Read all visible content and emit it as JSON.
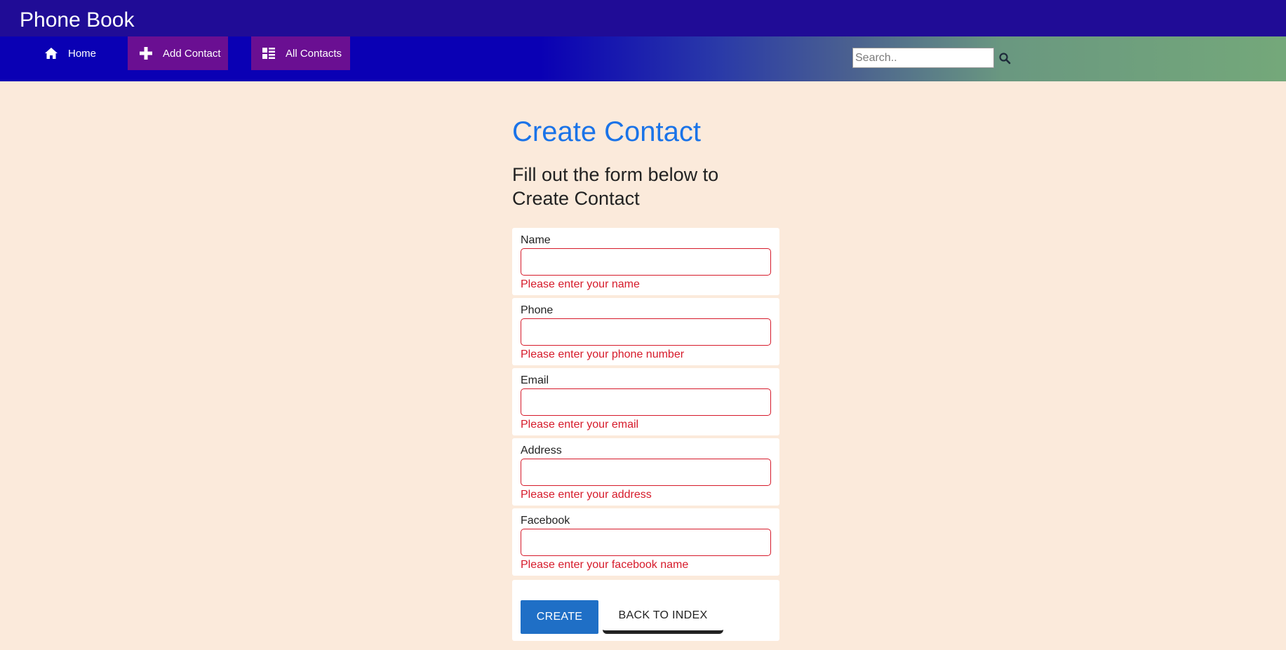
{
  "app": {
    "brand": "Phone Book"
  },
  "nav": {
    "home": "Home",
    "add_contact": "Add Contact",
    "all_contacts": "All Contacts",
    "search_placeholder": "Search..",
    "search_value": ""
  },
  "page": {
    "title": "Create Contact",
    "subtitle": "Fill out the form below to Create Contact"
  },
  "form": {
    "fields": [
      {
        "label": "Name",
        "value": "",
        "error": "Please enter your name"
      },
      {
        "label": "Phone",
        "value": "",
        "error": "Please enter your phone number"
      },
      {
        "label": "Email",
        "value": "",
        "error": "Please enter your email"
      },
      {
        "label": "Address",
        "value": "",
        "error": "Please enter your address"
      },
      {
        "label": "Facebook",
        "value": "",
        "error": "Please enter your facebook name"
      }
    ],
    "create_label": "CREATE",
    "back_label": "BACK TO INDEX"
  },
  "colors": {
    "title_bar": "#200c96",
    "nav_bar_start": "#0a00b4",
    "nav_bar_end": "#74a87a",
    "nav_button": "#6a0f92",
    "background": "#fbeadb",
    "title": "#1a73e8",
    "error": "#d61a2a",
    "primary_button": "#1f6fc6"
  },
  "icons": {
    "home": "home-icon",
    "add": "plus-icon",
    "list": "list-icon",
    "search": "search-icon"
  }
}
